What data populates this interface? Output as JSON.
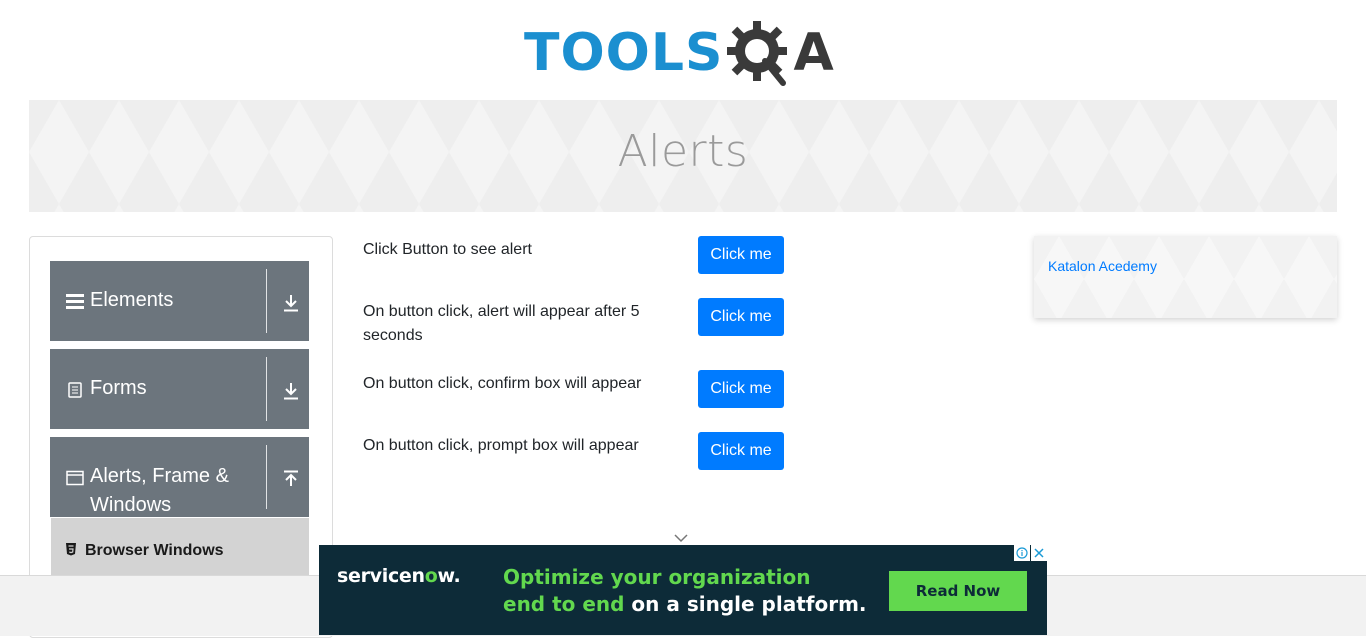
{
  "header": {
    "logo_tools": "TOOLS",
    "logo_a": "A",
    "logo_gear_icon": "gear-magnifier-icon"
  },
  "banner": {
    "title": "Alerts"
  },
  "sidebar": {
    "groups": [
      {
        "label": "Elements",
        "icon": "hamburger-icon",
        "toggle_icon": "download-arrow-icon"
      },
      {
        "label": "Forms",
        "icon": "document-icon",
        "toggle_icon": "download-arrow-icon"
      },
      {
        "label": "Alerts, Frame & Windows",
        "label_line1": "Alerts, Frame &",
        "label_line2": "Windows",
        "icon": "window-icon",
        "toggle_icon": "upload-arrow-icon"
      }
    ],
    "sub_items": [
      {
        "label": "Browser Windows",
        "icon": "html5-icon"
      }
    ]
  },
  "main": {
    "rows": [
      {
        "text": "Click Button to see alert",
        "button": "Click me"
      },
      {
        "text": "On button click, alert will appear after 5 seconds",
        "button": "Click me"
      },
      {
        "text": "On button click, confirm box will appear",
        "button": "Click me"
      },
      {
        "text": "On button click, prompt box will appear",
        "button": "Click me"
      }
    ]
  },
  "side_card": {
    "link": "Katalon Acedemy"
  },
  "ad": {
    "brand": "servicenow.",
    "brand_pre": "servicen",
    "brand_o": "o",
    "brand_post": "w.",
    "line1": "Optimize your organization",
    "line2_highlight": "end to end",
    "line2_rest": " on a single platform.",
    "cta": "Read Now",
    "info_icon": "info-icon",
    "close_icon": "close-icon"
  },
  "colors": {
    "primary_button": "#007bff",
    "sidebar_group": "#6c757d",
    "logo_blue": "#1b8fd0",
    "ad_bg": "#0d2b38",
    "ad_green": "#62d84e"
  }
}
